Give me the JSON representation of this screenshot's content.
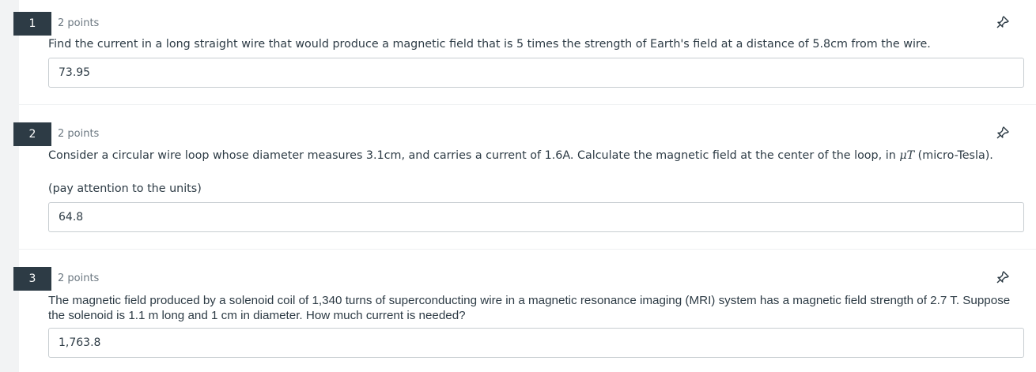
{
  "questions": [
    {
      "number": "1",
      "points": "2 points",
      "text": "Find the current in a long straight wire that would produce a magnetic field that is 5 times the strength of Earth's field at a distance of 5.8cm from the wire.",
      "answer": "73.95",
      "pin_icon": "pin-icon"
    },
    {
      "number": "2",
      "points": "2 points",
      "text_before_math": "Consider a circular wire loop whose diameter measures 3.1cm, and carries a current of 1.6A. Calculate the magnetic field at the center of the loop, in ",
      "math": "μT",
      "text_after_math": " (micro-Tesla).",
      "note": "(pay attention to the units)",
      "answer": "64.8",
      "pin_icon": "pin-icon"
    },
    {
      "number": "3",
      "points": "2 points",
      "text": "The magnetic field produced by a solenoid coil of 1,340 turns of superconducting wire in a magnetic resonance imaging (MRI) system has a magnetic field strength of 2.7 T. Suppose the solenoid is 1.1 m long and 1 cm in diameter. How much current is needed?",
      "answer": "1,763.8",
      "pin_icon": "pin-icon"
    }
  ]
}
